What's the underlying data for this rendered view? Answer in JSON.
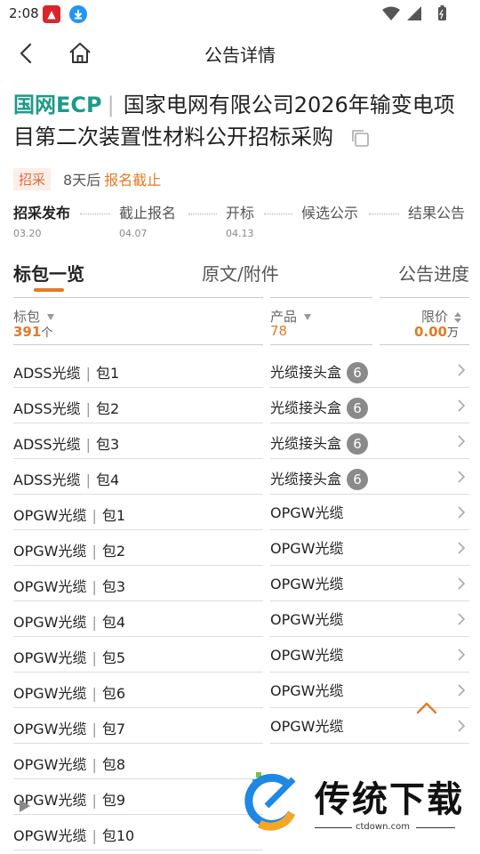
{
  "status_bar": {
    "time": "2:08"
  },
  "header": {
    "title": "公告详情"
  },
  "notice": {
    "brand": "国网ECP",
    "brand_separator": "|",
    "title": "国家电网有限公司2026年输变电项目第二次装置性材料公开招标采购",
    "category": "招采",
    "days_left": "8天后",
    "deadline_status": "报名截止"
  },
  "timeline": [
    {
      "label": "招采发布",
      "date": "03.20"
    },
    {
      "label": "截止报名",
      "date": "04.07"
    },
    {
      "label": "开标",
      "date": "04.13"
    },
    {
      "label": "候选公示",
      "date": ""
    },
    {
      "label": "结果公告",
      "date": ""
    }
  ],
  "tabs": [
    {
      "label": "标包一览"
    },
    {
      "label": "原文/附件"
    },
    {
      "label": "公告进度"
    }
  ],
  "filters": {
    "package": {
      "label": "标包",
      "value": "391",
      "unit": "个"
    },
    "product": {
      "label": "产品",
      "value": "78"
    },
    "price": {
      "label": "限价",
      "value": "0.00",
      "unit": "万"
    }
  },
  "rows": [
    {
      "name": "ADSS光缆",
      "pkg": "包1",
      "product": "光缆接头盒",
      "count": "6"
    },
    {
      "name": "ADSS光缆",
      "pkg": "包2",
      "product": "光缆接头盒",
      "count": "6"
    },
    {
      "name": "ADSS光缆",
      "pkg": "包3",
      "product": "光缆接头盒",
      "count": "6"
    },
    {
      "name": "ADSS光缆",
      "pkg": "包4",
      "product": "光缆接头盒",
      "count": "6"
    },
    {
      "name": "OPGW光缆",
      "pkg": "包1",
      "product": "OPGW光缆",
      "count": ""
    },
    {
      "name": "OPGW光缆",
      "pkg": "包2",
      "product": "OPGW光缆",
      "count": ""
    },
    {
      "name": "OPGW光缆",
      "pkg": "包3",
      "product": "OPGW光缆",
      "count": ""
    },
    {
      "name": "OPGW光缆",
      "pkg": "包4",
      "product": "OPGW光缆",
      "count": ""
    },
    {
      "name": "OPGW光缆",
      "pkg": "包5",
      "product": "OPGW光缆",
      "count": ""
    },
    {
      "name": "OPGW光缆",
      "pkg": "包6",
      "product": "OPGW光缆",
      "count": ""
    },
    {
      "name": "OPGW光缆",
      "pkg": "包7",
      "product": "OPGW光缆",
      "count": ""
    },
    {
      "name": "OPGW光缆",
      "pkg": "包8",
      "product": "",
      "count": ""
    },
    {
      "name": "OPGW光缆",
      "pkg": "包9",
      "product": "",
      "count": ""
    },
    {
      "name": "OPGW光缆",
      "pkg": "包10",
      "product": "",
      "count": ""
    }
  ],
  "watermark": {
    "title": "传统下载",
    "url": "ctdown.com"
  },
  "colors": {
    "brand": "#1f9a8a",
    "accent": "#e07b2a",
    "badge_bg": "#fbeee9"
  }
}
